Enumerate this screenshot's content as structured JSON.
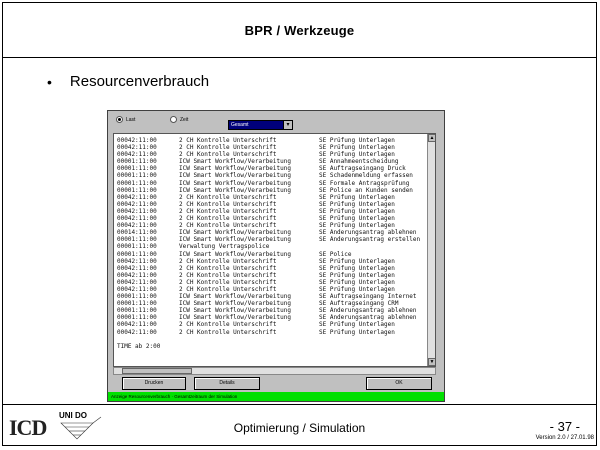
{
  "header": {
    "title": "BPR / Werkzeuge"
  },
  "bullet": {
    "text": "Resourcenverbrauch"
  },
  "footer": {
    "logo_icd": "ICD",
    "logo_uni": "UNI DO",
    "title": "Optimierung / Simulation",
    "page": "- 37 -",
    "version": "Version 2.0 / 27.01.98"
  },
  "window": {
    "radio_a": "Last",
    "radio_b": "Zeit",
    "combo_value": "Gesamt",
    "rows": [
      [
        "00042:11:00",
        "2 CH Kontrolle Unterschrift",
        "SE Prüfung Unterlagen"
      ],
      [
        "00042:11:00",
        "2 CH Kontrolle Unterschrift",
        "SE Prüfung Unterlagen"
      ],
      [
        "00042:11:00",
        "2 CH Kontrolle Unterschrift",
        "SE Prüfung Unterlagen"
      ],
      [
        "00001:11:00",
        "ICW Smart Workflow/Verarbeitung",
        "SE Annahmeentscheidung"
      ],
      [
        "00001:11:00",
        "ICW Smart Workflow/Verarbeitung",
        "SE Auftragseingang Druck"
      ],
      [
        "00001:11:00",
        "ICW Smart Workflow/Verarbeitung",
        "SE Schadenmeldung erfassen"
      ],
      [
        "00001:11:00",
        "ICW Smart Workflow/Verarbeitung",
        "SE Formale Antragsprüfung"
      ],
      [
        "00001:11:00",
        "ICW Smart Workflow/Verarbeitung",
        "SE Police an Kunden senden"
      ],
      [
        "00042:11:00",
        "2 CH Kontrolle Unterschrift",
        "SE Prüfung Unterlagen"
      ],
      [
        "00042:11:00",
        "2 CH Kontrolle Unterschrift",
        "SE Prüfung Unterlagen"
      ],
      [
        "00042:11:00",
        "2 CH Kontrolle Unterschrift",
        "SE Prüfung Unterlagen"
      ],
      [
        "00042:11:00",
        "2 CH Kontrolle Unterschrift",
        "SE Prüfung Unterlagen"
      ],
      [
        "00042:11:00",
        "2 CH Kontrolle Unterschrift",
        "SE Prüfung Unterlagen"
      ],
      [
        "00014:11:00",
        "ICW Smart Workflow/Verarbeitung",
        "SE Änderungsantrag ablehnen"
      ],
      [
        "00001:11:00",
        "ICW Smart Workflow/Verarbeitung",
        "SE Änderungsantrag erstellen"
      ],
      [
        "00001:11:00",
        "Verwaltung Vertragspolice",
        ""
      ],
      [
        "00001:11:00",
        "ICW Smart Workflow/Verarbeitung",
        "SE Police"
      ],
      [
        "00042:11:00",
        "2 CH Kontrolle Unterschrift",
        "SE Prüfung Unterlagen"
      ],
      [
        "00042:11:00",
        "2 CH Kontrolle Unterschrift",
        "SE Prüfung Unterlagen"
      ],
      [
        "00042:11:00",
        "2 CH Kontrolle Unterschrift",
        "SE Prüfung Unterlagen"
      ],
      [
        "00042:11:00",
        "2 CH Kontrolle Unterschrift",
        "SE Prüfung Unterlagen"
      ],
      [
        "00042:11:00",
        "2 CH Kontrolle Unterschrift",
        "SE Prüfung Unterlagen"
      ],
      [
        "00001:11:00",
        "ICW Smart Workflow/Verarbeitung",
        "SE Auftragseingang Internet"
      ],
      [
        "00001:11:00",
        "ICW Smart Workflow/Verarbeitung",
        "SE Auftragseingang CRM"
      ],
      [
        "00001:11:00",
        "ICW Smart Workflow/Verarbeitung",
        "SE Änderungsantrag ablehnen"
      ],
      [
        "00001:11:00",
        "ICW Smart Workflow/Verarbeitung",
        "SE Änderungsantrag ablehnen"
      ],
      [
        "00042:11:00",
        "2 CH Kontrolle Unterschrift",
        "SE Prüfung Unterlagen"
      ],
      [
        "00042:11:00",
        "2 CH Kontrolle Unterschrift",
        "SE Prüfung Unterlagen"
      ],
      [
        "",
        "",
        ""
      ],
      [
        "TIME ab 2:00",
        "",
        ""
      ]
    ],
    "btn_left": "Drucken",
    "btn_mid": "Details",
    "btn_right": "OK",
    "status": "Anzeige Resourcenverbrauch · Gesamtzeitraum der Simulation"
  }
}
